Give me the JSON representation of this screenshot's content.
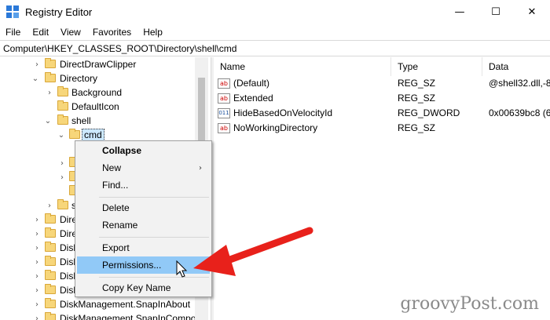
{
  "window": {
    "title": "Registry Editor"
  },
  "window_controls": {
    "minimize": "—",
    "maximize": "☐",
    "close": "✕"
  },
  "menu": [
    "File",
    "Edit",
    "View",
    "Favorites",
    "Help"
  ],
  "address": "Computer\\HKEY_CLASSES_ROOT\\Directory\\shell\\cmd",
  "tree": [
    {
      "label": "DirectDrawClipper"
    },
    {
      "label": "Directory"
    },
    {
      "label": "Background"
    },
    {
      "label": "DefaultIcon"
    },
    {
      "label": "shell"
    },
    {
      "label": "cmd"
    },
    {
      "label": ""
    },
    {
      "label": ""
    },
    {
      "label": ""
    },
    {
      "label": "s"
    },
    {
      "label": "Dire"
    },
    {
      "label": "Dire"
    },
    {
      "label": "Disk"
    },
    {
      "label": "Disk"
    },
    {
      "label": "Disk"
    },
    {
      "label": "Disk"
    },
    {
      "label": "DiskManagement.SnapInAbout"
    },
    {
      "label": "DiskManagement.SnapInCompo"
    }
  ],
  "columns": {
    "name": "Name",
    "type": "Type",
    "data": "Data"
  },
  "values": [
    {
      "icon": "ab",
      "name": "(Default)",
      "type": "REG_SZ",
      "data": "@shell32.dll,-8"
    },
    {
      "icon": "ab",
      "name": "Extended",
      "type": "REG_SZ",
      "data": ""
    },
    {
      "icon": "011",
      "name": "HideBasedOnVelocityId",
      "type": "REG_DWORD",
      "data": "0x00639bc8 (6"
    },
    {
      "icon": "ab",
      "name": "NoWorkingDirectory",
      "type": "REG_SZ",
      "data": ""
    }
  ],
  "context_menu": {
    "collapse": "Collapse",
    "new": "New",
    "find": "Find...",
    "delete": "Delete",
    "rename": "Rename",
    "export": "Export",
    "permissions": "Permissions...",
    "copy_key_name": "Copy Key Name"
  },
  "watermark": "groovyPost.com",
  "colors": {
    "arrow": "#e8211b",
    "highlight": "#91c9f7"
  }
}
